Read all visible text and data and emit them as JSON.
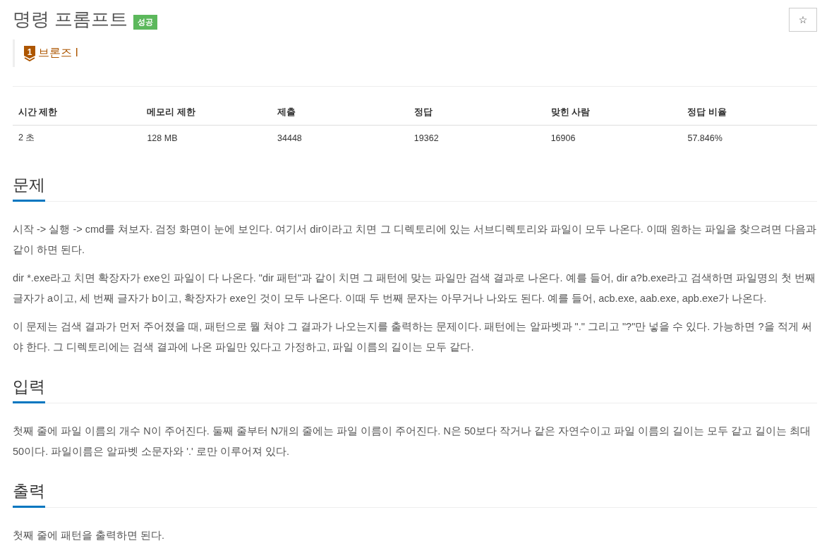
{
  "problem": {
    "title": "명령 프롬프트",
    "result_badge": "성공",
    "tier": {
      "badge": "1",
      "name": "브론즈 I"
    },
    "star_button": "☆"
  },
  "info_table": {
    "columns": [
      "시간 제한",
      "메모리 제한",
      "제출",
      "정답",
      "맞힌 사람",
      "정답 비율"
    ],
    "rows": [
      [
        "2 초",
        "128 MB",
        "34448",
        "19362",
        "16906",
        "57.846%"
      ]
    ]
  },
  "sections": [
    {
      "heading": "문제",
      "paragraphs": [
        "시작 -> 실행 -> cmd를 쳐보자. 검정 화면이 눈에 보인다. 여기서 dir이라고 치면 그 디렉토리에 있는 서브디렉토리와 파일이 모두 나온다. 이때 원하는 파일을 찾으려면 다음과 같이 하면 된다.",
        "dir *.exe라고 치면 확장자가 exe인 파일이 다 나온다. \"dir 패턴\"과 같이 치면 그 패턴에 맞는 파일만 검색 결과로 나온다. 예를 들어, dir a?b.exe라고 검색하면 파일명의 첫 번째 글자가 a이고, 세 번째 글자가 b이고, 확장자가 exe인 것이 모두 나온다. 이때 두 번째 문자는 아무거나 나와도 된다. 예를 들어, acb.exe, aab.exe, apb.exe가 나온다.",
        "이 문제는 검색 결과가 먼저 주어졌을 때, 패턴으로 뭘 쳐야 그 결과가 나오는지를 출력하는 문제이다. 패턴에는 알파벳과 \".\" 그리고 \"?\"만 넣을 수 있다. 가능하면 ?을 적게 써야 한다. 그 디렉토리에는 검색 결과에 나온 파일만 있다고 가정하고, 파일 이름의 길이는 모두 같다."
      ]
    },
    {
      "heading": "입력",
      "paragraphs": [
        "첫째 줄에 파일 이름의 개수 N이 주어진다. 둘째 줄부터 N개의 줄에는 파일 이름이 주어진다. N은 50보다 작거나 같은 자연수이고 파일 이름의 길이는 모두 같고 길이는 최대 50이다. 파일이름은 알파벳 소문자와 '.' 로만 이루어져 있다."
      ]
    },
    {
      "heading": "출력",
      "paragraphs": [
        "첫째 줄에 패턴을 출력하면 된다."
      ]
    }
  ]
}
